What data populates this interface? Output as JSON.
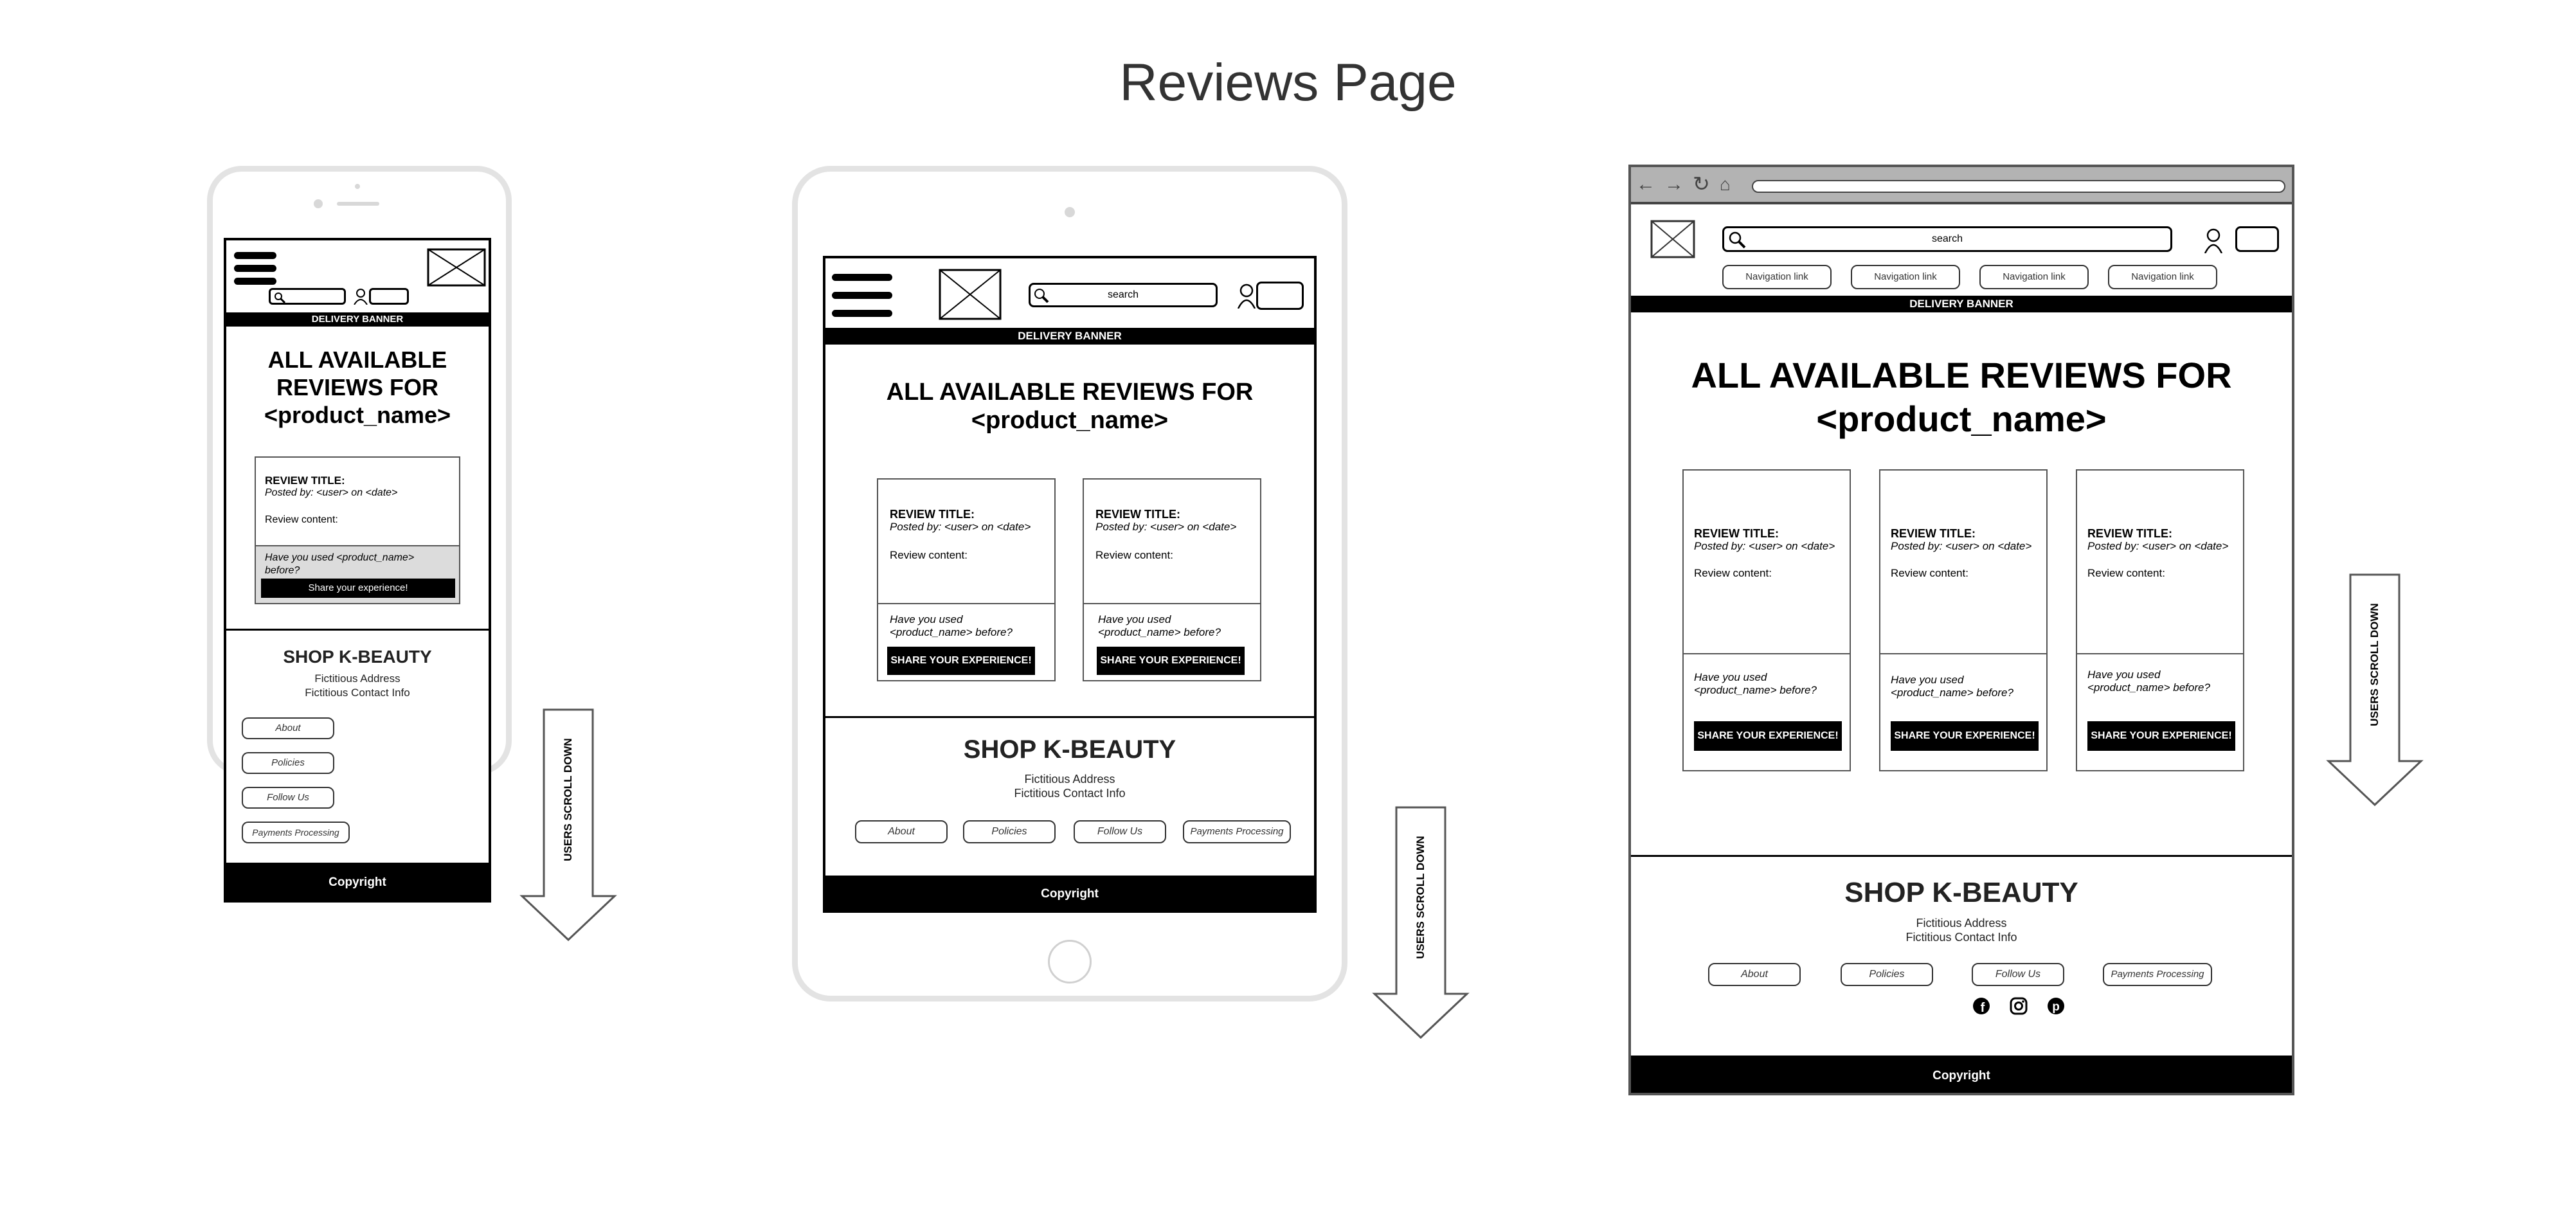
{
  "page_title": "Reviews Page",
  "common": {
    "delivery_banner": "DELIVERY BANNER",
    "reviews_heading": "ALL AVAILABLE REVIEWS FOR <product_name>",
    "reviews_heading_line1": "ALL AVAILABLE REVIEWS FOR",
    "reviews_heading_line2": "<product_name>",
    "mobile_heading_l1": "ALL AVAILABLE",
    "mobile_heading_l2": "REVIEWS FOR",
    "mobile_heading_l3": "<product_name>",
    "review_title": "REVIEW TITLE:",
    "posted_by": "Posted by: <user> on <date>",
    "review_content": "Review content:",
    "used_before": "Have you used <product_name> before?",
    "used_before_l1": "Have you used",
    "used_before_l2": "<product_name> before?",
    "mobile_used_l1": "Have you used <product_name>",
    "mobile_used_l2": "before?",
    "share_caps": "SHARE YOUR EXPERIENCE!",
    "share_mixed": "Share your experience!",
    "shop_title": "SHOP K-BEAUTY",
    "address": "Fictitious Address",
    "contact": "Fictitious Contact Info",
    "copyright": "Copyright",
    "scroll_note": "USERS SCROLL DOWN",
    "search_placeholder": "search"
  },
  "footer_links": [
    "About",
    "Policies",
    "Follow Us",
    "Payments Processing"
  ],
  "nav_links": [
    "Navigation link",
    "Navigation link",
    "Navigation link",
    "Navigation link"
  ],
  "social_icons": [
    "facebook-icon",
    "instagram-icon",
    "pinterest-icon"
  ]
}
